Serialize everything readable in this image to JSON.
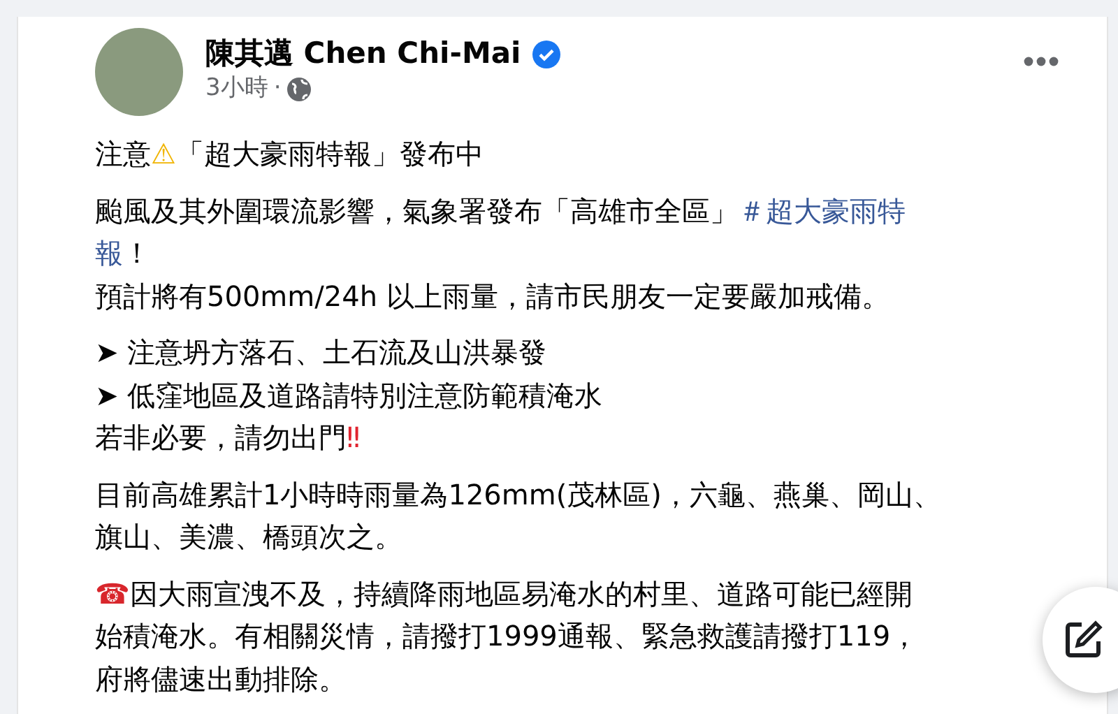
{
  "post": {
    "author": "陳其邁 Chen Chi-Mai",
    "verified": true,
    "time": "3小時",
    "separator": "·",
    "paragraphs": [
      {
        "lines": [
          [
            {
              "kind": "text",
              "text": "注意"
            },
            {
              "kind": "symbol",
              "text": "⚠",
              "color": "#f0b400"
            },
            {
              "kind": "text",
              "text": "「超大豪雨特報」發布中"
            }
          ]
        ]
      },
      {
        "lines": [
          [
            {
              "kind": "text",
              "text": "颱風及其外圍環流影響，氣象署發布「高雄市全區」 "
            },
            {
              "kind": "hashtag",
              "text": "＃超大豪雨特"
            }
          ],
          [
            {
              "kind": "hashtag",
              "text": "報"
            },
            {
              "kind": "text",
              "text": "！"
            }
          ],
          [
            {
              "kind": "text",
              "text": "預計將有500mm/24h 以上雨量，請市民朋友一定要嚴加戒備。"
            }
          ]
        ]
      },
      {
        "lines": [
          [
            {
              "kind": "text",
              "text": "➤ 注意坍方落石、土石流及山洪暴發"
            }
          ],
          [
            {
              "kind": "text",
              "text": "➤ 低窪地區及道路請特別注意防範積淹水"
            }
          ],
          [
            {
              "kind": "text",
              "text": "若非必要，請勿出門"
            },
            {
              "kind": "symbol",
              "text": "‼",
              "color": "#e0242f"
            }
          ]
        ]
      },
      {
        "lines": [
          [
            {
              "kind": "text",
              "text": "目前高雄累計1小時時雨量為126mm(茂林區)，六龜、燕巢、岡山、"
            }
          ],
          [
            {
              "kind": "text",
              "text": "旗山、美濃、橋頭次之。"
            }
          ]
        ]
      },
      {
        "lines": [
          [
            {
              "kind": "symbol",
              "text": "☎",
              "color": "#d8262c"
            },
            {
              "kind": "text",
              "text": "因大雨宣洩不及，持續降雨地區易淹水的村里、道路可能已經開"
            }
          ],
          [
            {
              "kind": "text",
              "text": "始積淹水。有相關災情，請撥打1999通報、緊急救護請撥打119，"
            }
          ],
          [
            {
              "kind": "text",
              "text": "府將儘速出動排除。"
            }
          ]
        ]
      }
    ]
  }
}
